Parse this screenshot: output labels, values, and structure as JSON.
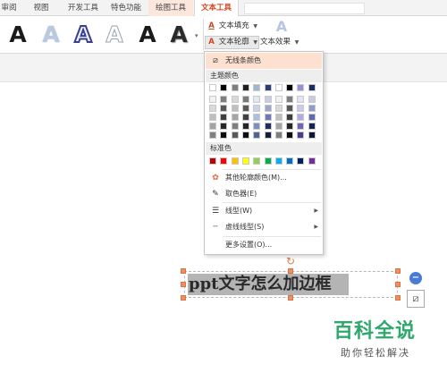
{
  "tabs": [
    {
      "label": "审阅"
    },
    {
      "label": "视图"
    },
    {
      "label": "开发工具"
    },
    {
      "label": "特色功能"
    },
    {
      "label": "绘图工具"
    },
    {
      "label": "文本工具"
    }
  ],
  "ribbon": {
    "text_fill": "文本填充",
    "text_outline": "文本轮廓",
    "text_effect": "文本效果",
    "gallery_glyph": "A"
  },
  "outline_menu": {
    "no_line": "无线条颜色",
    "theme_colors": "主题颜色",
    "standard_colors": "标准色",
    "more_outline_colors": "其他轮廓颜色(M)...",
    "eyedropper": "取色器(E)",
    "line_style": "线型(W)",
    "dash_style": "虚线线型(S)",
    "more_settings": "更多设置(O)..."
  },
  "theme_colors_top": [
    "#ffffff",
    "#000000",
    "#7f7f7f",
    "#1f1f1f",
    "#9fb6d5",
    "#2b3f78",
    "#ffffff",
    "#000000",
    "#9a8fd6",
    "#1a2e66"
  ],
  "theme_colors_tints": [
    [
      "#f2f2f2",
      "#7f7f7f",
      "#d8d8d8",
      "#7a7a7a",
      "#e3e9f3",
      "#c7cde6",
      "#f2f2f2",
      "#7f7f7f",
      "#e6e3f5",
      "#c6cbe3"
    ],
    [
      "#d9d9d9",
      "#595959",
      "#bfbfbf",
      "#5a5a5a",
      "#c8d4e8",
      "#9ba5d0",
      "#d9d9d9",
      "#595959",
      "#cdc8ee",
      "#8f9bcc"
    ],
    [
      "#bfbfbf",
      "#3f3f3f",
      "#a5a5a5",
      "#404040",
      "#aebfdd",
      "#6d7ab8",
      "#bfbfbf",
      "#3f3f3f",
      "#b4abe6",
      "#5b6bb2"
    ],
    [
      "#a5a5a5",
      "#262626",
      "#7f7f7f",
      "#262626",
      "#7a92bd",
      "#1f2e5a",
      "#a5a5a5",
      "#262626",
      "#7063b8",
      "#14244d"
    ],
    [
      "#7f7f7f",
      "#0c0c0c",
      "#595959",
      "#0d0d0d",
      "#4d6690",
      "#151f3d",
      "#7f7f7f",
      "#0c0c0c",
      "#4a3f8a",
      "#0d1833"
    ]
  ],
  "standard_colors_list": [
    "#c00000",
    "#ff0000",
    "#ffc000",
    "#ffff00",
    "#92d050",
    "#00b050",
    "#00b0f0",
    "#0070c0",
    "#002060",
    "#7030a0"
  ],
  "textbox": {
    "text": "ppt文字怎么加边框"
  },
  "watermark": {
    "title": "百科全说",
    "subtitle": "助你轻松解决"
  },
  "colors": {
    "accent": "#d2461f",
    "highlight": "#fde0cf",
    "watermark_green": "#2fa86b",
    "handle": "#e8906a"
  },
  "icons": {
    "no_line": "slash-box-icon",
    "more_colors": "color-wheel-icon",
    "eyedropper": "eyedropper-icon",
    "line_style": "line-weight-icon",
    "dash_style": "dash-line-icon",
    "rotate": "rotate-handle-icon",
    "minus": "minus-circle-icon",
    "layout": "layout-options-icon"
  }
}
